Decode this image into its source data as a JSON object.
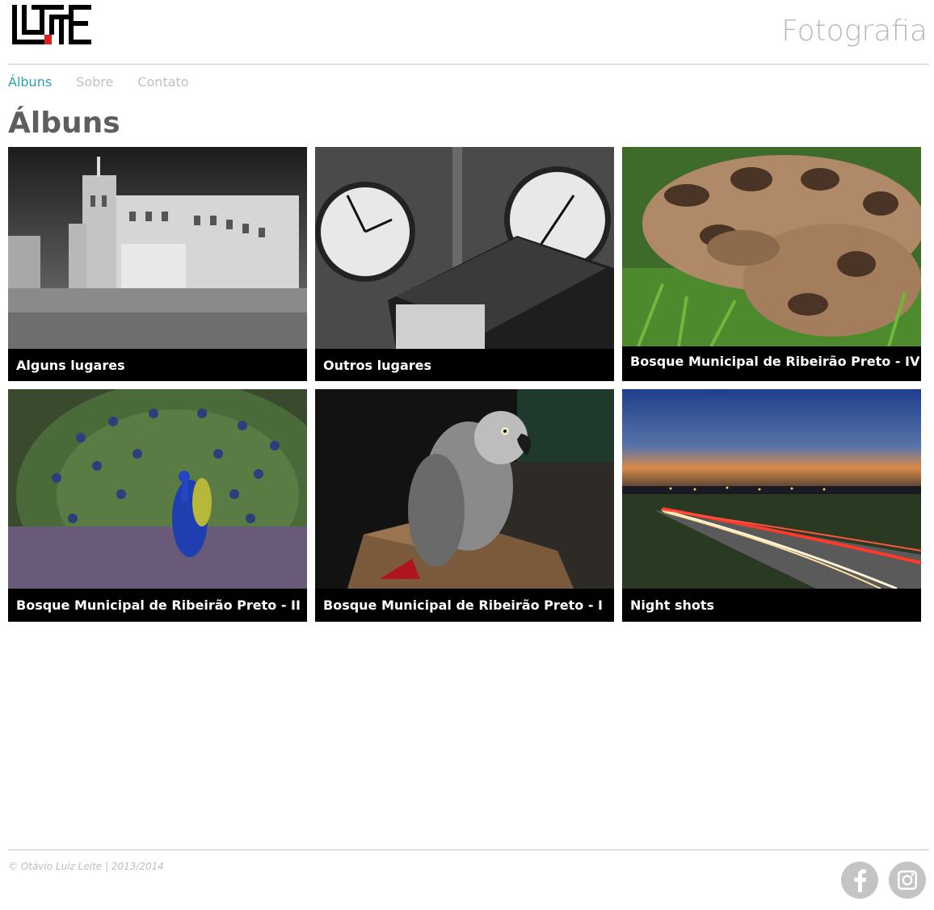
{
  "header": {
    "tagline": "Fotografia"
  },
  "nav": {
    "items": [
      {
        "label": "Álbuns",
        "active": true
      },
      {
        "label": "Sobre",
        "active": false
      },
      {
        "label": "Contato",
        "active": false
      }
    ]
  },
  "main": {
    "title": "Álbuns",
    "albums": [
      {
        "caption": "Alguns lugares"
      },
      {
        "caption": "Outros lugares"
      },
      {
        "caption": "Bosque Municipal de Ribeirão Preto - IV"
      },
      {
        "caption": "Bosque Municipal de Ribeirão Preto - II"
      },
      {
        "caption": "Bosque Municipal de Ribeirão Preto - I"
      },
      {
        "caption": "Night shots"
      }
    ]
  },
  "footer": {
    "copyright": "© Otávio Luiz Leite | 2013/2014",
    "social": [
      {
        "icon": "facebook-icon"
      },
      {
        "icon": "instagram-icon"
      }
    ]
  },
  "colors": {
    "accent": "#2aa1b3",
    "nav_inactive": "#c0c0c0",
    "caption_bg": "#000000",
    "logo_red": "#e02020"
  }
}
